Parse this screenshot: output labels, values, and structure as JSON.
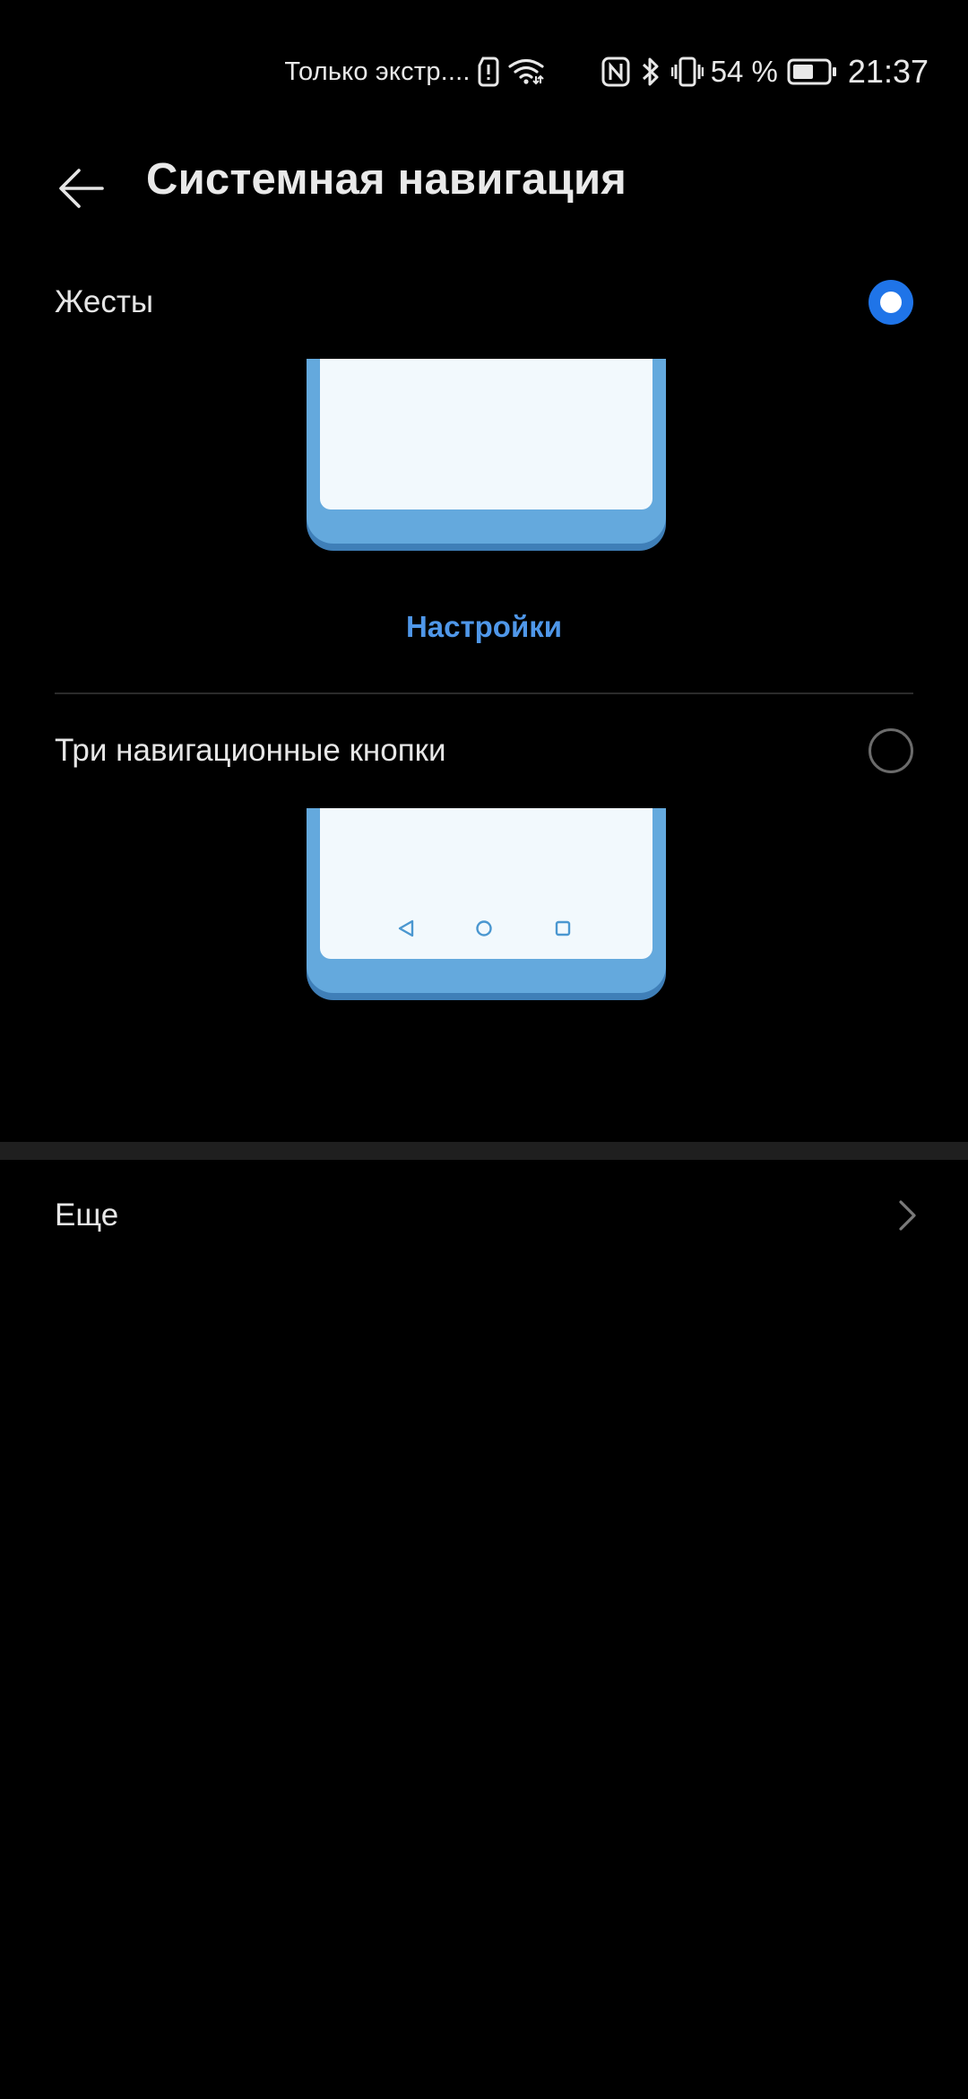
{
  "status_bar": {
    "carrier": "Только экстр....",
    "battery_percent": "54 %",
    "time": "21:37",
    "icons": [
      "sim-alert-icon",
      "wifi-icon",
      "nfc-icon",
      "bluetooth-icon",
      "vibrate-icon",
      "battery-icon"
    ]
  },
  "header": {
    "back_icon": "arrow-left-icon",
    "title": "Системная навигация"
  },
  "options": [
    {
      "label": "Жесты",
      "selected": true
    },
    {
      "label": "Три навигационные кнопки",
      "selected": false
    }
  ],
  "gestures_settings_link": "Настройки",
  "more": {
    "label": "Еще",
    "icon": "chevron-right-icon"
  },
  "colors": {
    "background": "#000000",
    "accent": "#1f74e8",
    "link": "#4f97e9",
    "phone_frame": "#64a9dd",
    "phone_screen": "#f2f9fd"
  }
}
